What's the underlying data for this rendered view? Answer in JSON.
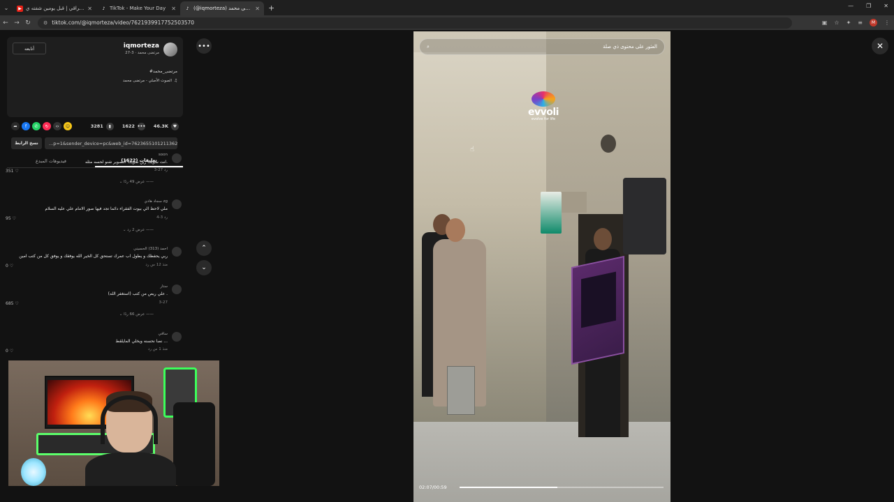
{
  "browser": {
    "tabs": [
      {
        "title": "اغاني عراقي | قبل يومين شفته ي",
        "icon": "youtube-icon",
        "active": false
      },
      {
        "title": "TikTok - Make Your Day",
        "icon": "tiktok-icon",
        "active": false
      },
      {
        "title": "(@iqmorteza) مرتضى محمد",
        "icon": "tiktok-icon",
        "active": true
      }
    ],
    "new_tab": "+",
    "url": "tiktok.com/@iqmorteza/video/7621939917752503570",
    "extension_badge": "M"
  },
  "author": {
    "follow_label": "أتابعه",
    "username": "iqmorteza",
    "subtitle": "مرتضى محمد · 3-27",
    "hashtag": "#مرتضى_محمد",
    "sound": "الصوت الأصلي - مرتضى محمد"
  },
  "stats": {
    "likes": "46.3K",
    "comments": "1622",
    "saves": "3281"
  },
  "link": {
    "copy_label": "نسخ الرابط",
    "value": "...p=1&sender_device=pc&web_id=762365510121136283б"
  },
  "content_tabs": {
    "comments": "(1622) تعليقات",
    "creator_videos": "فيديوهات المبدع"
  },
  "comments": [
    {
      "name": "soon",
      "text": "انت سويت زين سويت التصوير شنو لحسه مثله.",
      "meta": "3-27   رد",
      "likes": "351",
      "replies": "عرض 49 ردًا"
    },
    {
      "name": "سجاد هادي zg",
      "text": "ملي لاحظ الي بيوت الفقراء دائما تجد فيها صور الامام علي عليه السلام",
      "meta": "4-3   رد",
      "likes": "95",
      "replies": "عرض 2 رد"
    },
    {
      "name": "احمد (313) الحسيني",
      "text": "ربي يحفظك و يطول اب عمرك تستحق كل الخير الله يوفقك و يوفق كل من كتب امين",
      "meta": "منذ 12 س   رد",
      "likes": "0",
      "replies": ""
    },
    {
      "name": "ستار",
      "text": "علي ربص من كتب (استغفر الله) .",
      "meta": "3-27",
      "likes": "685",
      "replies": "عرض 66 ردًا"
    },
    {
      "name": "ساقي",
      "text": "نصا نحسنه ويخلي المايلقط ...",
      "meta": "منذ 1 س   رد",
      "likes": "0",
      "replies": ""
    }
  ],
  "video": {
    "search_placeholder": "العثور على محتوى ذي صلة",
    "logo_name": "evvoli",
    "logo_tagline": "evolve for life",
    "time": "02:07/00:59",
    "progress": 0.48
  },
  "icons": {
    "more": "•••",
    "close": "✕",
    "up": "⌃",
    "down": "⌄"
  }
}
